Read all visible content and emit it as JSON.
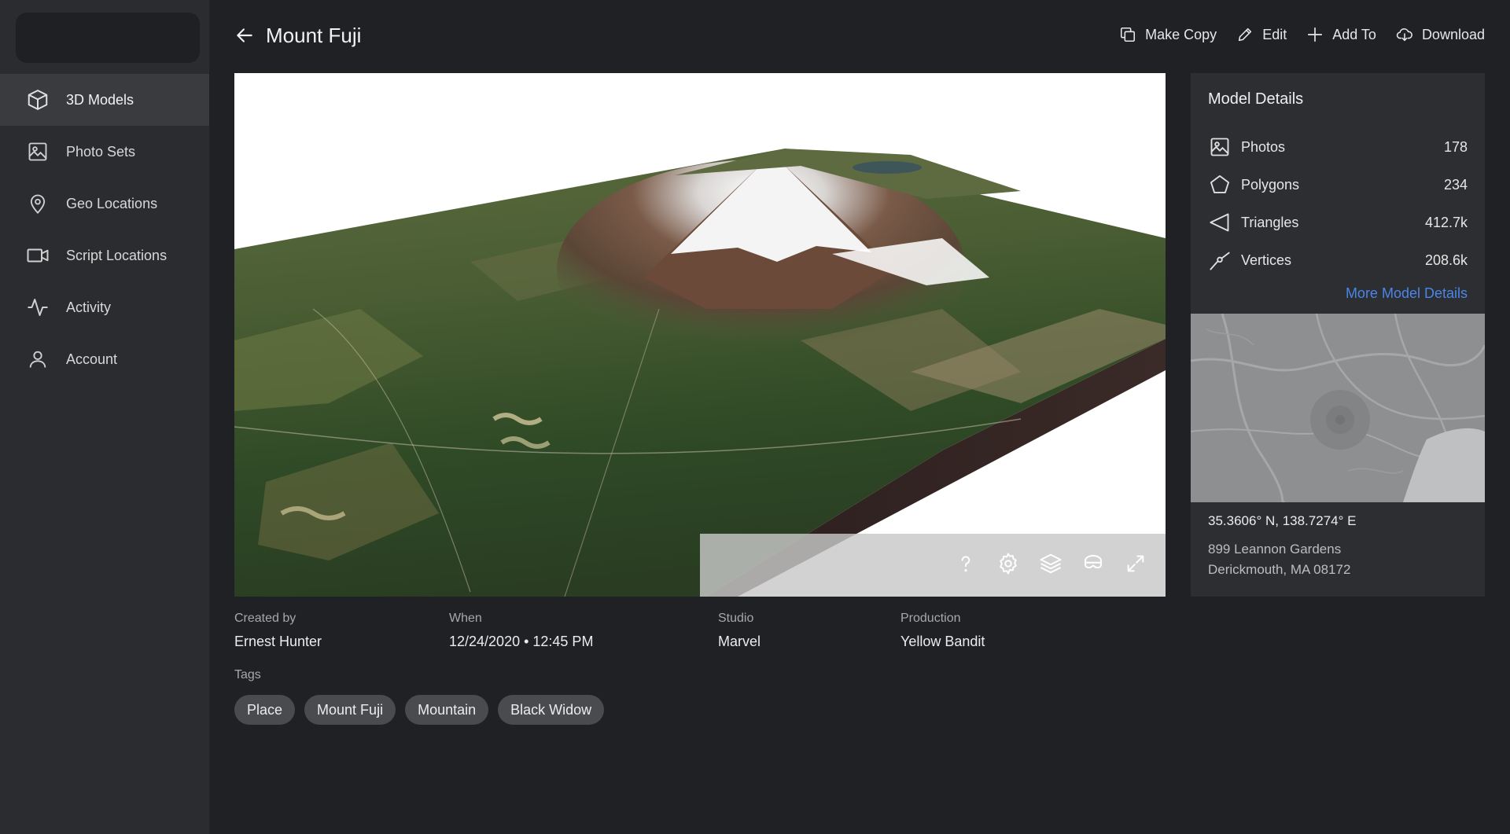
{
  "sidebar": {
    "items": [
      {
        "label": "3D Models",
        "icon": "cube-icon",
        "active": true
      },
      {
        "label": "Photo Sets",
        "icon": "image-icon"
      },
      {
        "label": "Geo Locations",
        "icon": "map-pin-icon"
      },
      {
        "label": "Script Locations",
        "icon": "video-camera-icon"
      },
      {
        "label": "Activity",
        "icon": "activity-icon"
      },
      {
        "label": "Account",
        "icon": "user-icon"
      }
    ]
  },
  "header": {
    "title": "Mount Fuji",
    "actions": [
      {
        "label": "Make Copy",
        "icon": "copy-icon"
      },
      {
        "label": "Edit",
        "icon": "pencil-icon"
      },
      {
        "label": "Add To",
        "icon": "plus-icon"
      },
      {
        "label": "Download",
        "icon": "cloud-download-icon"
      }
    ]
  },
  "viewer": {
    "tools": [
      "help-icon",
      "settings-icon",
      "layers-icon",
      "vr-headset-icon",
      "expand-icon"
    ]
  },
  "meta": {
    "created_by": {
      "label": "Created by",
      "value": "Ernest Hunter"
    },
    "when": {
      "label": "When",
      "value": "12/24/2020 • 12:45 PM"
    },
    "studio": {
      "label": "Studio",
      "value": "Marvel"
    },
    "production": {
      "label": "Production",
      "value": "Yellow Bandit"
    }
  },
  "tags": {
    "label": "Tags",
    "items": [
      "Place",
      "Mount Fuji",
      "Mountain",
      "Black Widow"
    ]
  },
  "details": {
    "title": "Model Details",
    "stats": [
      {
        "name": "Photos",
        "value": "178",
        "icon": "image-icon"
      },
      {
        "name": "Polygons",
        "value": "234",
        "icon": "pentagon-icon"
      },
      {
        "name": "Triangles",
        "value": "412.7k",
        "icon": "triangle-icon"
      },
      {
        "name": "Vertices",
        "value": "208.6k",
        "icon": "vertex-icon"
      }
    ],
    "more_link": "More Model Details",
    "coords": "35.3606° N, 138.7274° E",
    "address_line1": "899 Leannon Gardens",
    "address_line2": "Derickmouth, MA 08172"
  },
  "colors": {
    "background": "#202124",
    "sidebar": "#2b2c2f",
    "panel": "#2d2e31",
    "accent_link": "#4a86e8",
    "tag": "#4a4b4f"
  }
}
